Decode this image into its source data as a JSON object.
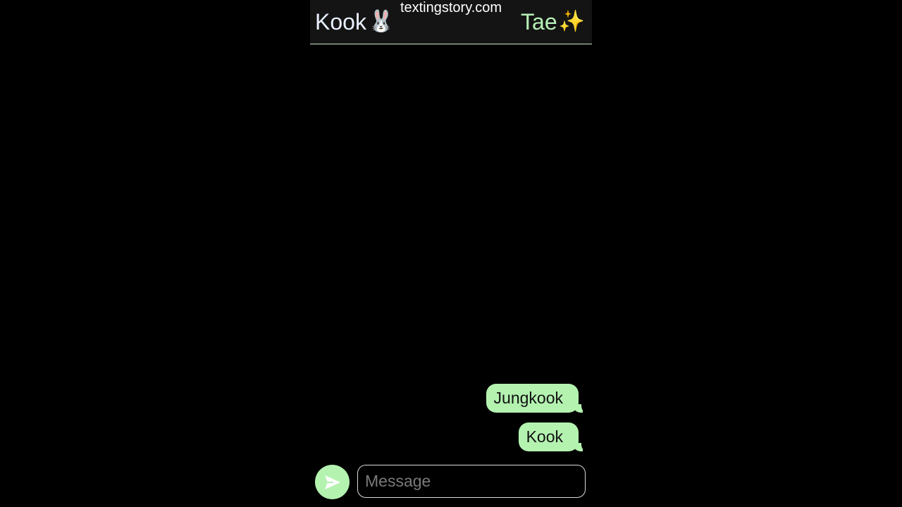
{
  "header": {
    "watermark": "textingstory.com",
    "left_contact": "Kook",
    "left_emoji": "🐰",
    "right_contact": "Tae",
    "right_emoji": "✨"
  },
  "messages": [
    {
      "text": "Jungkook",
      "sender": "Tae"
    },
    {
      "text": "Kook",
      "sender": "Tae"
    }
  ],
  "composer": {
    "placeholder": "Message",
    "send_icon": "send-arrow-icon"
  },
  "colors": {
    "bubble": "#b4f2b0",
    "background": "#000000",
    "header": "#141414"
  }
}
